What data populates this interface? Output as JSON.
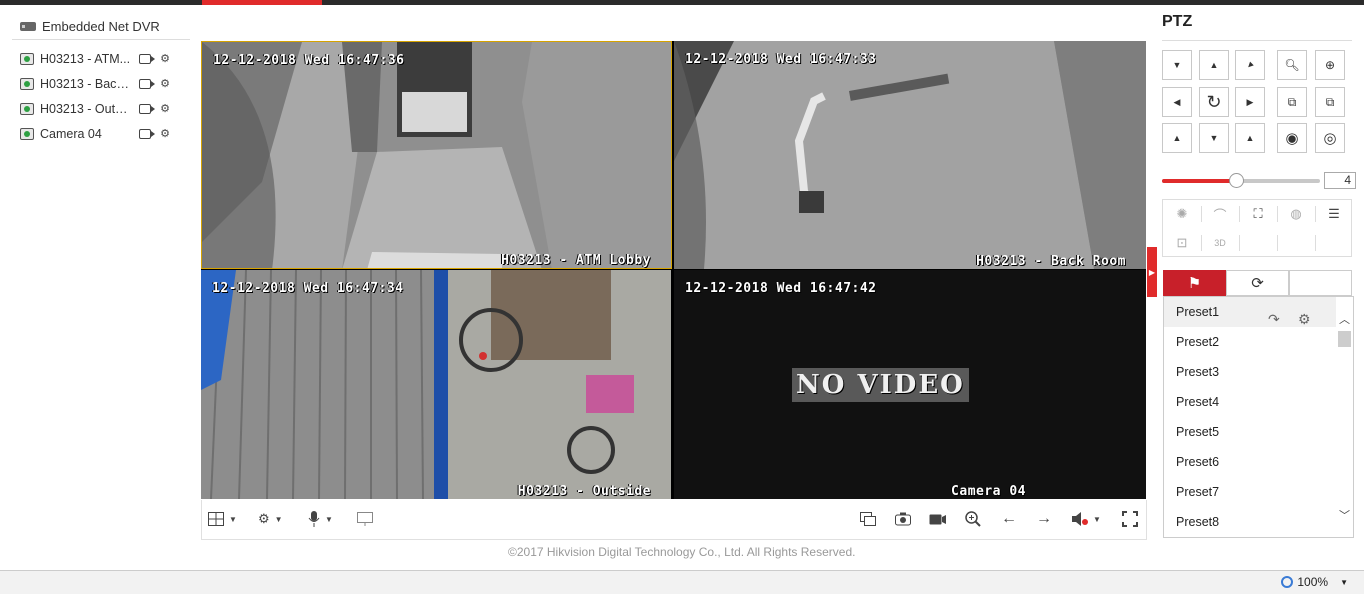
{
  "tree": {
    "root": "Embedded Net DVR",
    "cameras": [
      {
        "name": "H03213 - ATM..."
      },
      {
        "name": "H03213 - Back..."
      },
      {
        "name": "H03213 - Outsi..."
      },
      {
        "name": "Camera 04"
      }
    ]
  },
  "video": {
    "tiles": [
      {
        "timestamp": "12-12-2018 Wed 16:47:36",
        "label": "H03213 - ATM Lobby"
      },
      {
        "timestamp": "12-12-2018 Wed 16:47:33",
        "label": "H03213 - Back Room"
      },
      {
        "timestamp": "12-12-2018 Wed 16:47:34",
        "label": "H03213 - Outside"
      },
      {
        "timestamp": "12-12-2018 Wed 16:47:42",
        "label": "Camera 04",
        "no_video": "NO VIDEO"
      }
    ]
  },
  "footer": {
    "copyright": "©2017 Hikvision Digital Technology Co., Ltd. All Rights Reserved."
  },
  "status": {
    "zoom": "100%"
  },
  "ptz": {
    "title": "PTZ",
    "speed": "4",
    "speed_level": 0.47,
    "presets": [
      "Preset1",
      "Preset2",
      "Preset3",
      "Preset4",
      "Preset5",
      "Preset6",
      "Preset7",
      "Preset8"
    ]
  },
  "colors": {
    "accent": "#e02b2b",
    "selected_border": "#d6a300"
  }
}
